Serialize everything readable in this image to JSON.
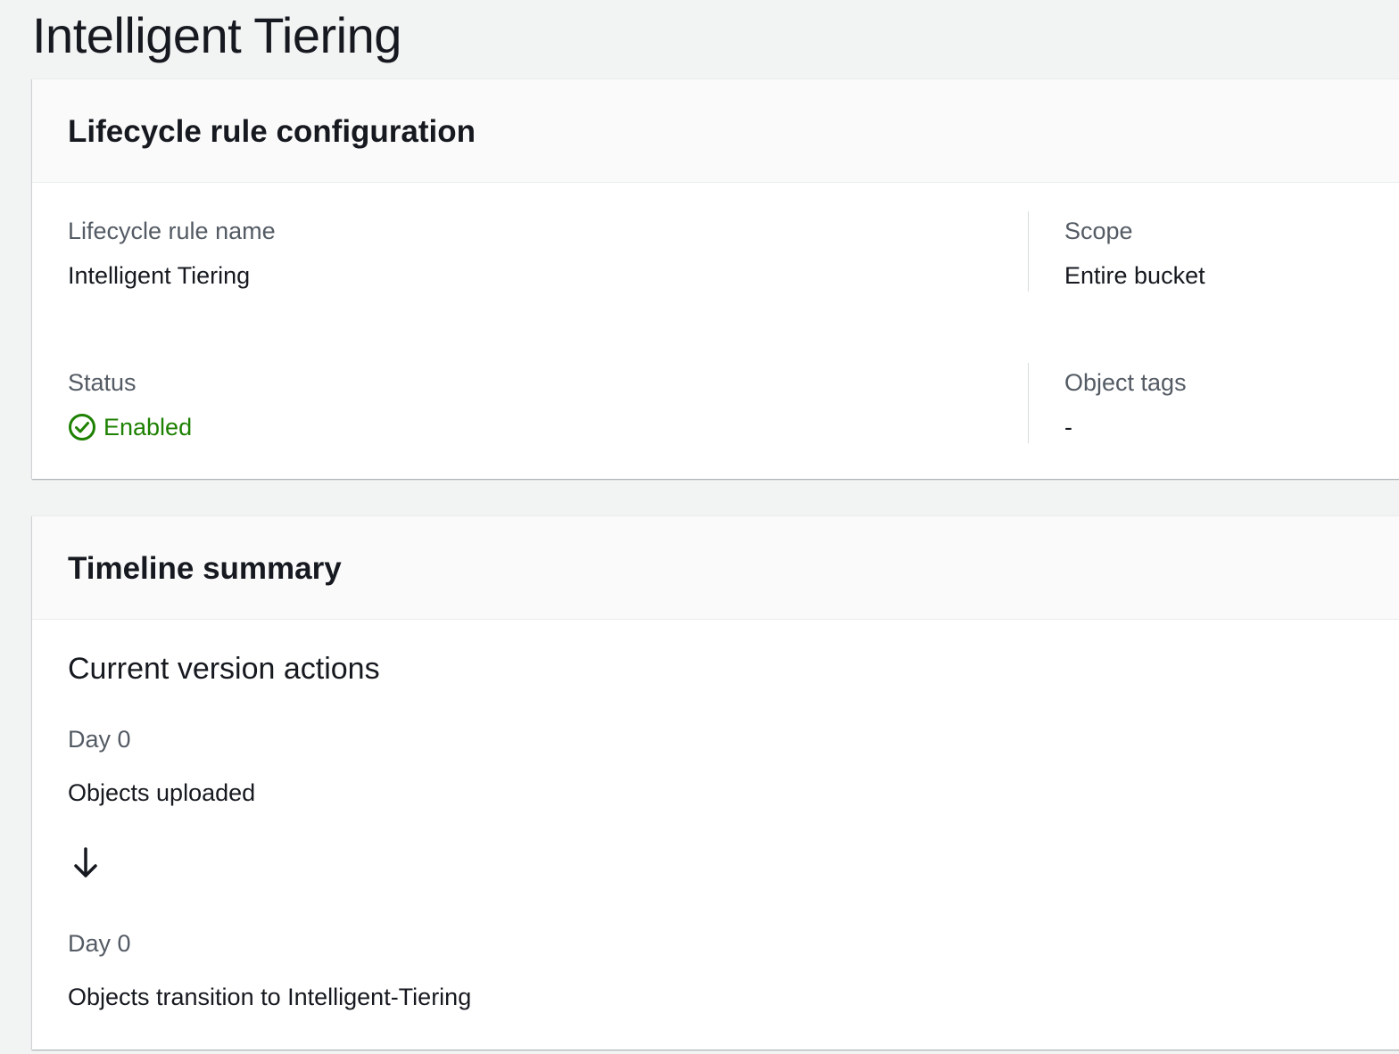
{
  "page": {
    "title": "Intelligent Tiering"
  },
  "config_panel": {
    "title": "Lifecycle rule configuration",
    "rule_name_label": "Lifecycle rule name",
    "rule_name_value": "Intelligent Tiering",
    "scope_label": "Scope",
    "scope_value": "Entire bucket",
    "status_label": "Status",
    "status_value": "Enabled",
    "status_icon": "check-circle-icon",
    "status_color": "#1d8102",
    "tags_label": "Object tags",
    "tags_value": "-"
  },
  "timeline_panel": {
    "title": "Timeline summary",
    "section_title": "Current version actions",
    "steps": [
      {
        "day": "Day 0",
        "action": "Objects uploaded"
      },
      {
        "day": "Day 0",
        "action": "Objects transition to Intelligent-Tiering"
      }
    ],
    "arrow_icon": "arrow-down-icon"
  }
}
